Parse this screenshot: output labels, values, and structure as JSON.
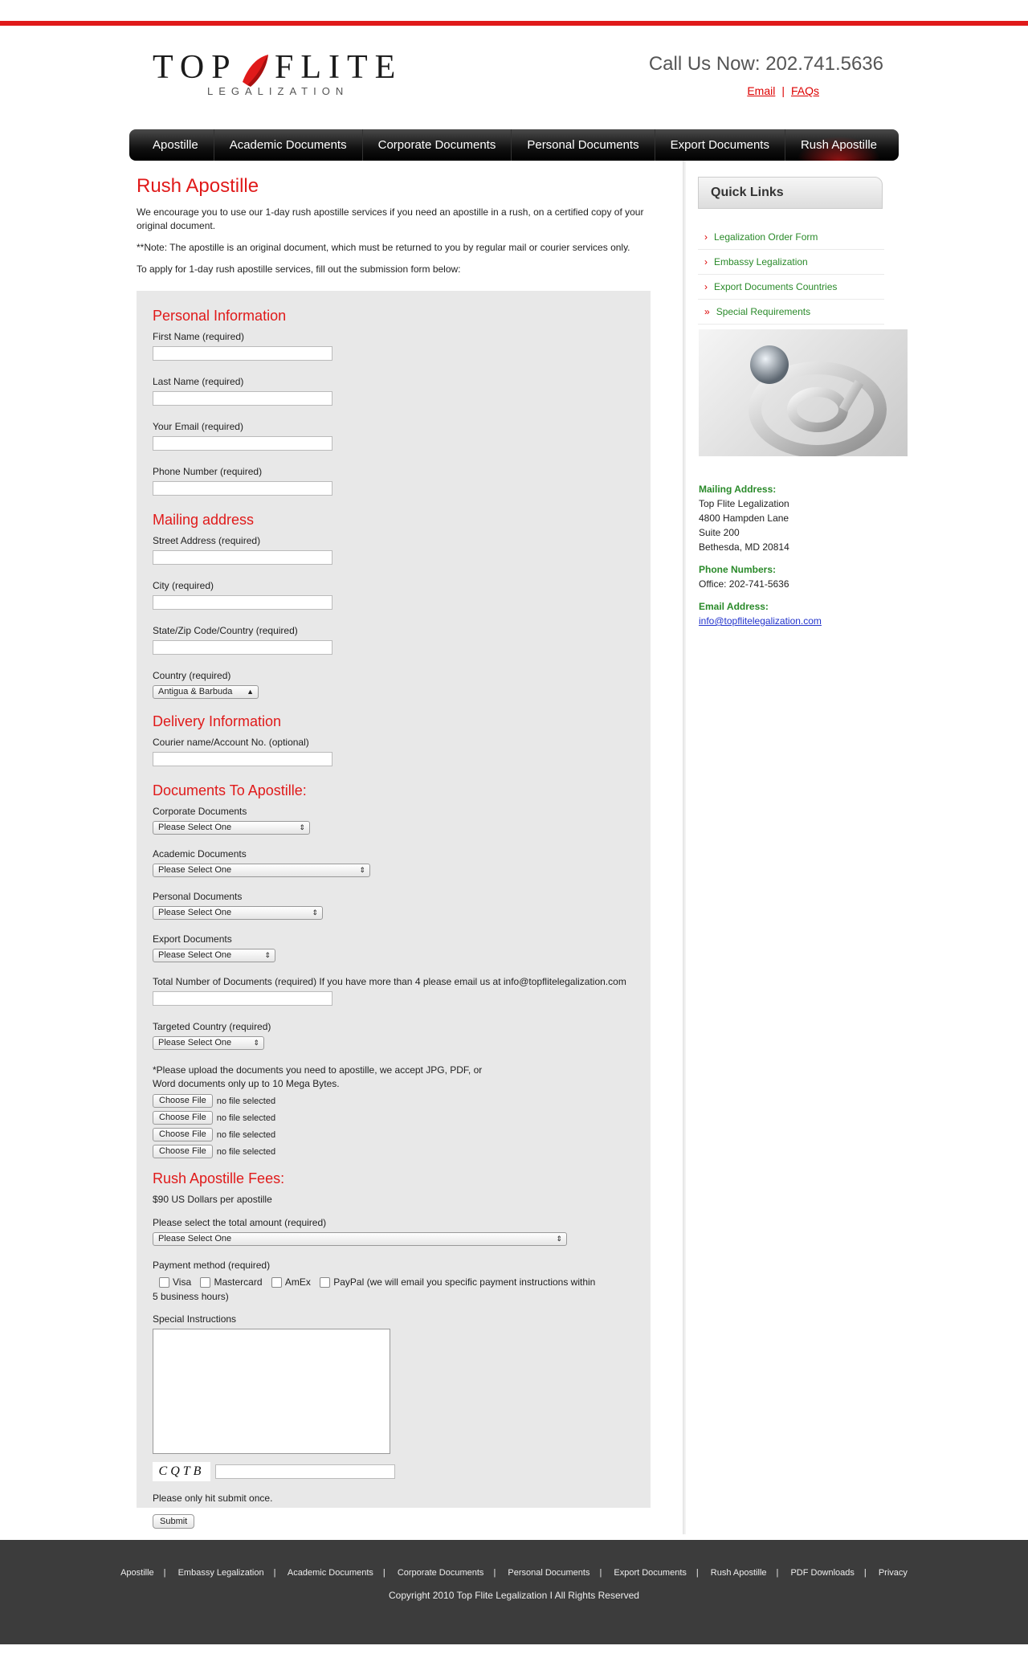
{
  "header": {
    "logo_word1": "TOP",
    "logo_word2": "FLITE",
    "logo_sub": "LEGALIZATION",
    "callus": "Call Us Now: 202.741.5636",
    "email_link": "Email",
    "faqs_link": "FAQs",
    "separator": "|"
  },
  "nav": {
    "items": [
      "Apostille",
      "Academic Documents",
      "Corporate Documents",
      "Personal Documents",
      "Export Documents",
      "Rush Apostille"
    ],
    "active": "Rush Apostille"
  },
  "main": {
    "title": "Rush Apostille",
    "intro": "We encourage you to use our 1-day rush apostille services if you need an apostille in a rush, on a certified copy of your original document.",
    "note": "**Note: The apostille is an original document, which must be returned to you by regular mail or courier services only.",
    "apply": "To apply for 1-day rush apostille services, fill out the submission form below:"
  },
  "form": {
    "personal_heading": "Personal Information",
    "first_name": "First Name (required)",
    "last_name": "Last Name (required)",
    "email": "Your Email (required)",
    "phone": "Phone Number (required)",
    "mailing_heading": "Mailing address",
    "street": "Street Address (required)",
    "city": "City (required)",
    "state_zip": "State/Zip Code/Country (required)",
    "country": "Country (required)",
    "country_value": "Antigua & Barbuda",
    "delivery_heading": "Delivery Information",
    "courier": "Courier name/Account No. (optional)",
    "docs_heading": "Documents To Apostille:",
    "corporate_docs": "Corporate Documents",
    "academic_docs": "Academic Documents",
    "personal_docs": "Personal Documents",
    "export_docs": "Export Documents",
    "select_one": "Please Select One",
    "total_docs": "Total Number of Documents (required) If you have more than 4 please email us at info@topflitelegalization.com",
    "targeted_country": "Targeted Country (required)",
    "upload_note": "*Please upload the documents you need to apostille, we accept JPG, PDF, or Word documents only up to 10 Mega Bytes.",
    "choose_file": "Choose File",
    "no_file": "no file selected",
    "fees_heading": "Rush Apostille Fees:",
    "fee_text": "$90 US Dollars per apostille",
    "total_amount": "Please select the total amount (required)",
    "payment_method": "Payment method (required)",
    "visa": "Visa",
    "mastercard": "Mastercard",
    "amex": "AmEx",
    "paypal": "PayPal (we will email you specific payment instructions within 5 business hours)",
    "special": "Special Instructions",
    "captcha_text": "CQTB",
    "submit_once": "Please only hit submit once.",
    "submit": "Submit"
  },
  "sidebar": {
    "quick_links_title": "Quick Links",
    "links": [
      "Legalization Order Form",
      "Embassy Legalization",
      "Export Documents Countries",
      "Special Requirements"
    ],
    "mailing_heading": "Mailing Address:",
    "mailing_lines": [
      "Top Flite Legalization",
      "4800 Hampden Lane",
      "Suite 200",
      "Bethesda, MD 20814"
    ],
    "phone_heading": "Phone Numbers:",
    "phone_office": "Office: 202-741-5636",
    "email_heading": "Email Address:",
    "email_value": "info@topflitelegalization.com"
  },
  "footer": {
    "links": [
      "Apostille",
      "Embassy Legalization",
      "Academic Documents",
      "Corporate Documents",
      "Personal Documents",
      "Export Documents",
      "Rush Apostille",
      "PDF Downloads",
      "Privacy"
    ],
    "copyright": "Copyright 2010 Top Flite Legalization I All Rights Reserved"
  },
  "colors": {
    "accent_red": "#e01a1a",
    "link_green": "#2a8a2a",
    "footer_bg": "#3c3c3c"
  }
}
